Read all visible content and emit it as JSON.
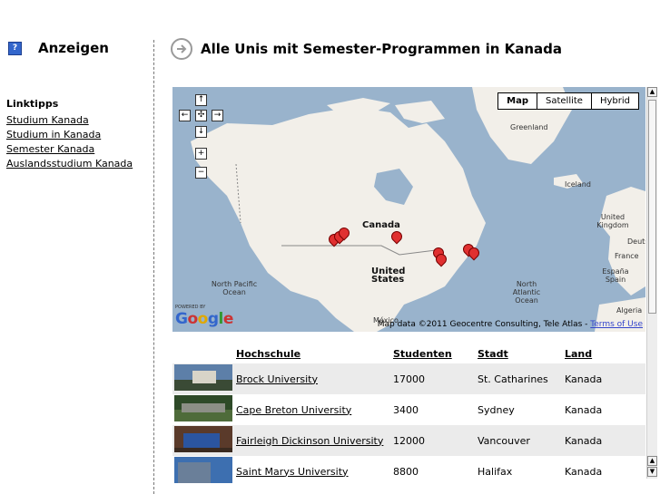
{
  "sidebar": {
    "ad_title": "Anzeigen",
    "links_title": "Linktipps",
    "links": [
      "Studium Kanada",
      "Studium in Kanada",
      "Semester Kanada",
      "Auslandsstudium Kanada"
    ]
  },
  "page_title": "Alle Unis mit Semester-Programmen in Kanada",
  "map": {
    "types": [
      "Map",
      "Satellite",
      "Hybrid"
    ],
    "selected_type": "Map",
    "labels": {
      "greenland": "Greenland",
      "iceland": "Iceland",
      "canada": "Canada",
      "united_states": "United States",
      "north_pacific": "North Pacific Ocean",
      "north_atlantic": "North Atlantic Ocean",
      "uk": "United Kingdom",
      "france": "France",
      "spain": "España Spain",
      "algeria": "Algeria",
      "mexico": "México",
      "deutsch": "Deuts"
    },
    "powered_by": "POWERED BY",
    "logo": "Google",
    "copyright": "Map data ©2011 Geocentre Consulting, Tele Atlas - ",
    "terms": "Terms of Use",
    "colors": {
      "water": "#99b3cc",
      "land": "#f2efe9",
      "pin": "#e03030"
    }
  },
  "table": {
    "headers": [
      "Hochschule",
      "Studenten",
      "Stadt",
      "Land"
    ],
    "rows": [
      {
        "name": "Brock University",
        "students": "17000",
        "city": "St. Catharines",
        "country": "Kanada"
      },
      {
        "name": "Cape Breton University",
        "students": "3400",
        "city": "Sydney",
        "country": "Kanada"
      },
      {
        "name": "Fairleigh Dickinson University",
        "students": "12000",
        "city": "Vancouver",
        "country": "Kanada"
      },
      {
        "name": "Saint Marys University",
        "students": "8800",
        "city": "Halifax",
        "country": "Kanada"
      }
    ]
  }
}
